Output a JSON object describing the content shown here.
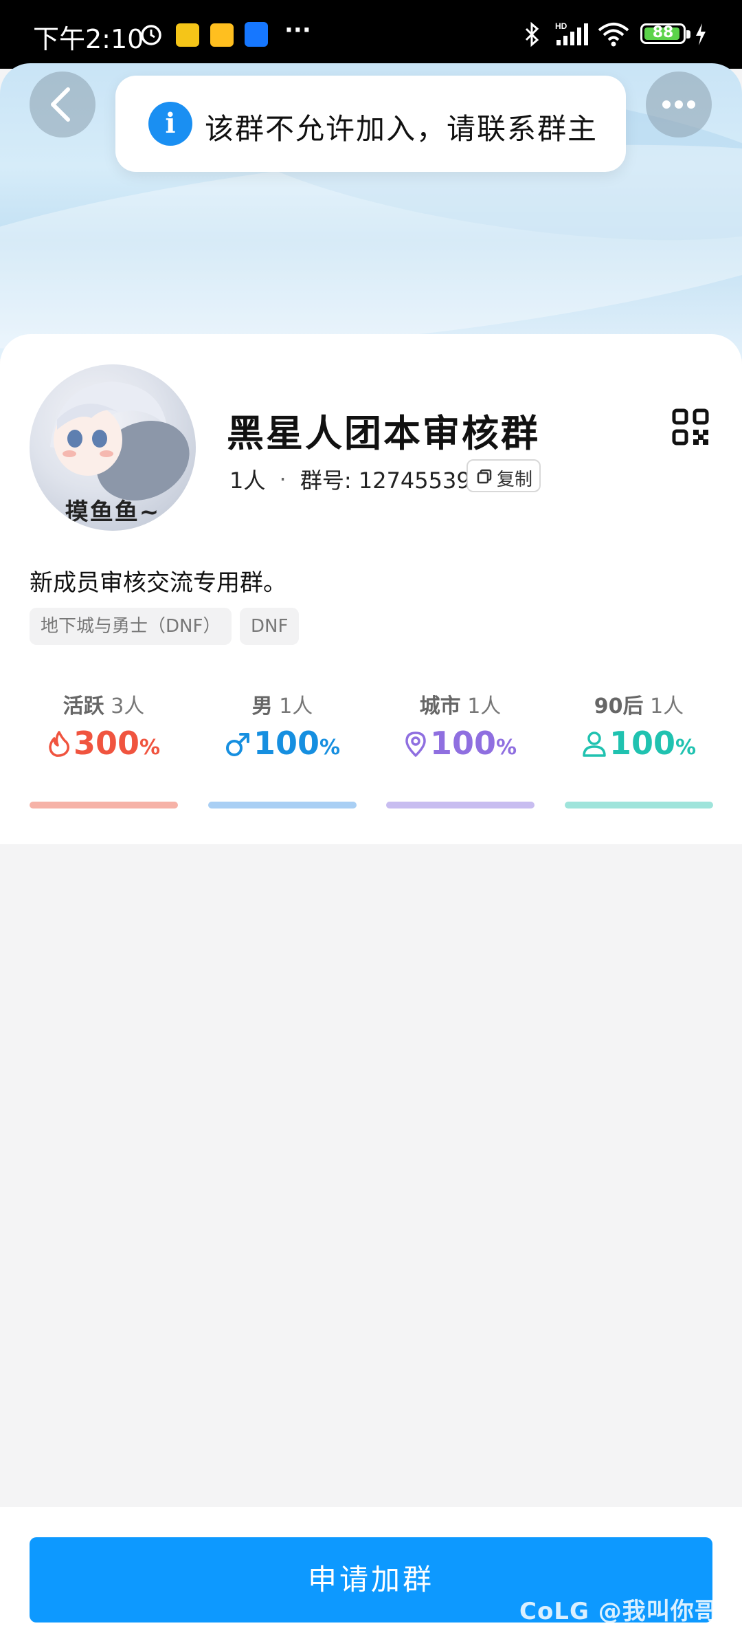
{
  "status_bar": {
    "time": "下午2:10",
    "more": "···",
    "battery": "88"
  },
  "toast": {
    "text": "该群不允许加入，请联系群主"
  },
  "group": {
    "avatar_caption": "摸鱼鱼~",
    "name": "黑星人团本审核群",
    "members": "1人",
    "separator": "·",
    "id_label": "群号: 127455390",
    "copy_label": "复制",
    "description": "新成员审核交流专用群。",
    "tags": [
      "地下城与勇士（DNF）",
      "DNF"
    ]
  },
  "stats": [
    {
      "label": "活跃",
      "count": "3人",
      "value": "300",
      "unit": "%",
      "color": "#f0543f",
      "bar_color": "#f6b2a7",
      "icon": "flame-icon"
    },
    {
      "label": "男",
      "count": "1人",
      "value": "100",
      "unit": "%",
      "color": "#168fe0",
      "bar_color": "#a9cff4",
      "icon": "male-icon"
    },
    {
      "label": "城市",
      "count": "1人",
      "value": "100",
      "unit": "%",
      "color": "#8f6fe0",
      "bar_color": "#c8bdf0",
      "icon": "location-pin-icon"
    },
    {
      "label": "90后",
      "count": "1人",
      "value": "100",
      "unit": "%",
      "color": "#20c2b0",
      "bar_color": "#9fe4db",
      "icon": "person-icon"
    }
  ],
  "bottom": {
    "apply_label": "申请加群"
  },
  "watermark": "CoLG @我叫你哥",
  "colors": {
    "primary": "#0d99ff",
    "info": "#1a8ff2"
  }
}
